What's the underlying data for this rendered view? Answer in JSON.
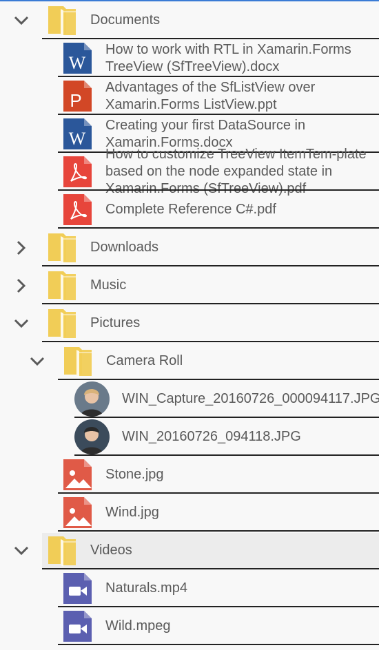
{
  "tree": [
    {
      "kind": "folder",
      "level": 0,
      "expanded": true,
      "icon": "folder-icon",
      "label": "Documents"
    },
    {
      "kind": "file",
      "level": 1,
      "icon": "word-doc-icon",
      "label": "How to work with RTL in Xamarin.Forms TreeView (SfTreeView).docx"
    },
    {
      "kind": "file",
      "level": 1,
      "icon": "powerpoint-icon",
      "label": "Advantages of the SfListView over Xamarin.Forms ListView.ppt"
    },
    {
      "kind": "file",
      "level": 1,
      "icon": "word-doc-icon",
      "label": "Creating your first DataSource in Xamarin.Forms.docx"
    },
    {
      "kind": "file",
      "level": 1,
      "icon": "pdf-icon",
      "label": "How to customize TreeView ItemTem-plate based on the node expanded state in Xamarin.Forms (SfTreeView).pdf"
    },
    {
      "kind": "file",
      "level": 1,
      "icon": "pdf-icon",
      "label": "Complete Reference C#.pdf"
    },
    {
      "kind": "folder",
      "level": 0,
      "expanded": false,
      "icon": "folder-icon",
      "label": "Downloads"
    },
    {
      "kind": "folder",
      "level": 0,
      "expanded": false,
      "icon": "folder-icon",
      "label": "Music"
    },
    {
      "kind": "folder",
      "level": 0,
      "expanded": true,
      "icon": "folder-icon",
      "label": "Pictures"
    },
    {
      "kind": "folder",
      "level": 1,
      "expanded": true,
      "icon": "folder-icon",
      "label": "Camera Roll"
    },
    {
      "kind": "photo",
      "level": 2,
      "icon": "photo-avatar-icon",
      "label": "WIN_Capture_20160726_000094117.JPG"
    },
    {
      "kind": "photo",
      "level": 2,
      "icon": "photo-avatar-icon",
      "label": "WIN_20160726_094118.JPG"
    },
    {
      "kind": "file",
      "level": 1,
      "icon": "image-file-icon",
      "label": "Stone.jpg"
    },
    {
      "kind": "file",
      "level": 1,
      "icon": "image-file-icon",
      "label": "Wind.jpg"
    },
    {
      "kind": "folder",
      "level": 0,
      "expanded": true,
      "selected": true,
      "icon": "folder-icon",
      "label": "Videos"
    },
    {
      "kind": "file",
      "level": 1,
      "icon": "video-file-icon",
      "label": "Naturals.mp4"
    },
    {
      "kind": "file",
      "level": 1,
      "icon": "video-file-icon",
      "label": "Wild.mpeg"
    }
  ],
  "colors": {
    "folder": "#f1cd57",
    "word": "#2b579a",
    "powerpoint": "#d24726",
    "pdf": "#e7453b",
    "image": "#e05a47",
    "video": "#5b5fb0",
    "separator": "#222222",
    "text": "#5a5a5a",
    "selected_row": "#ececec"
  }
}
